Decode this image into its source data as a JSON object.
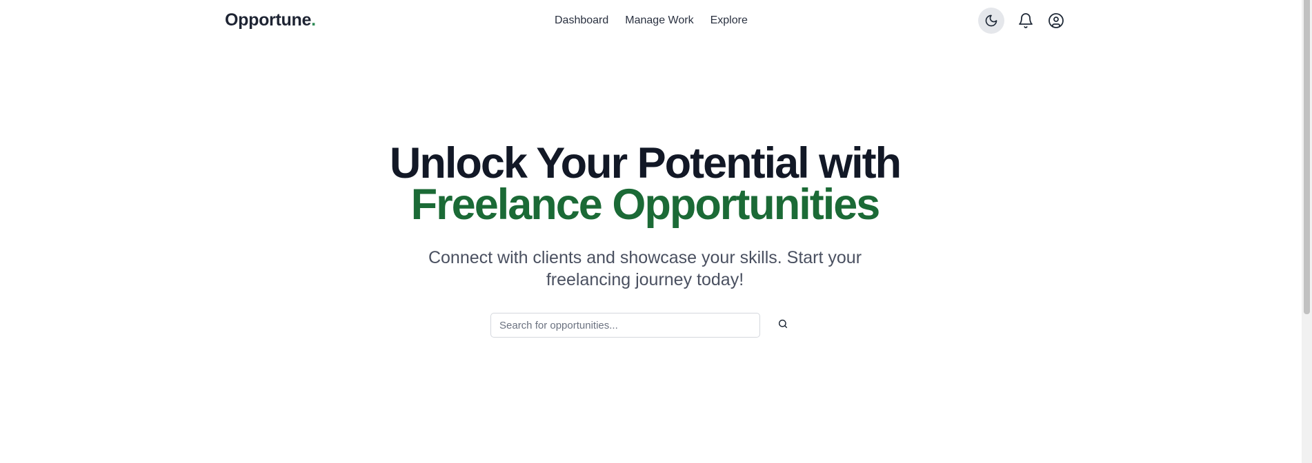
{
  "header": {
    "logo_text": "Opportune",
    "logo_dot": ".",
    "nav": [
      {
        "label": "Dashboard"
      },
      {
        "label": "Manage Work"
      },
      {
        "label": "Explore"
      }
    ],
    "icons": {
      "theme": "moon-icon",
      "notifications": "bell-icon",
      "profile": "user-circle-icon"
    }
  },
  "hero": {
    "title_line1": "Unlock Your Potential with",
    "title_line2": "Freelance Opportunities",
    "subtitle_line1": "Connect with clients and showcase your skills. Start your",
    "subtitle_line2": "freelancing journey today!"
  },
  "search": {
    "placeholder": "Search for opportunities...",
    "value": "",
    "icon": "search-icon"
  },
  "colors": {
    "brand_green": "#1b6a36",
    "logo_dot": "#2e8b57",
    "heading": "#121826",
    "text": "#2a3140"
  }
}
